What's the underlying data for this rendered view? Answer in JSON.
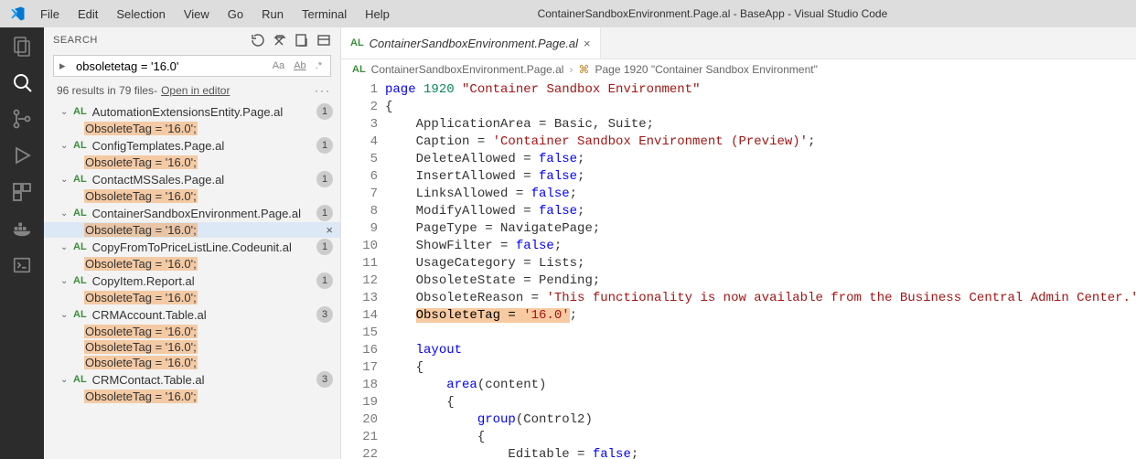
{
  "window_title": "ContainerSandboxEnvironment.Page.al - BaseApp - Visual Studio Code",
  "menubar": [
    "File",
    "Edit",
    "Selection",
    "View",
    "Go",
    "Run",
    "Terminal",
    "Help"
  ],
  "sidebar": {
    "heading": "SEARCH",
    "search_value": "obsoletetag = '16.0'",
    "results_count": "96 results in 79 files",
    "open_in_editor": "Open in editor",
    "match_text": "ObsoleteTag = '16.0';",
    "files": [
      {
        "name": "AutomationExtensionsEntity.Page.al",
        "badge": "1",
        "matches": 1
      },
      {
        "name": "ConfigTemplates.Page.al",
        "badge": "1",
        "matches": 1
      },
      {
        "name": "ContactMSSales.Page.al",
        "badge": "1",
        "matches": 1
      },
      {
        "name": "ContainerSandboxEnvironment.Page.al",
        "badge": "1",
        "matches": 1,
        "selected": true,
        "showClose": true
      },
      {
        "name": "CopyFromToPriceListLine.Codeunit.al",
        "badge": "1",
        "matches": 1
      },
      {
        "name": "CopyItem.Report.al",
        "badge": "1",
        "matches": 1
      },
      {
        "name": "CRMAccount.Table.al",
        "badge": "3",
        "matches": 3
      },
      {
        "name": "CRMContact.Table.al",
        "badge": "3",
        "matches": 1,
        "truncated": true
      }
    ]
  },
  "tabs": [
    {
      "type": "AL",
      "label": "ContainerSandboxEnvironment.Page.al",
      "italic": true
    }
  ],
  "breadcrumb": {
    "file": "ContainerSandboxEnvironment.Page.al",
    "symbol": "Page 1920 \"Container Sandbox Environment\""
  },
  "code": {
    "lines": [
      {
        "n": 1,
        "tokens": [
          [
            "kw",
            "page"
          ],
          [
            "sp",
            " "
          ],
          [
            "num",
            "1920"
          ],
          [
            "sp",
            " "
          ],
          [
            "str",
            "\"Container Sandbox Environment\""
          ]
        ]
      },
      {
        "n": 2,
        "tokens": [
          [
            "punc",
            "{"
          ]
        ]
      },
      {
        "n": 3,
        "tokens": [
          [
            "sp",
            "    "
          ],
          [
            "ident",
            "ApplicationArea = Basic, Suite;"
          ]
        ]
      },
      {
        "n": 4,
        "tokens": [
          [
            "sp",
            "    "
          ],
          [
            "ident",
            "Caption = "
          ],
          [
            "str",
            "'Container Sandbox Environment (Preview)'"
          ],
          [
            "ident",
            ";"
          ]
        ]
      },
      {
        "n": 5,
        "tokens": [
          [
            "sp",
            "    "
          ],
          [
            "ident",
            "DeleteAllowed = "
          ],
          [
            "kw",
            "false"
          ],
          [
            "ident",
            ";"
          ]
        ]
      },
      {
        "n": 6,
        "tokens": [
          [
            "sp",
            "    "
          ],
          [
            "ident",
            "InsertAllowed = "
          ],
          [
            "kw",
            "false"
          ],
          [
            "ident",
            ";"
          ]
        ]
      },
      {
        "n": 7,
        "tokens": [
          [
            "sp",
            "    "
          ],
          [
            "ident",
            "LinksAllowed = "
          ],
          [
            "kw",
            "false"
          ],
          [
            "ident",
            ";"
          ]
        ]
      },
      {
        "n": 8,
        "tokens": [
          [
            "sp",
            "    "
          ],
          [
            "ident",
            "ModifyAllowed = "
          ],
          [
            "kw",
            "false"
          ],
          [
            "ident",
            ";"
          ]
        ]
      },
      {
        "n": 9,
        "tokens": [
          [
            "sp",
            "    "
          ],
          [
            "ident",
            "PageType = NavigatePage;"
          ]
        ]
      },
      {
        "n": 10,
        "tokens": [
          [
            "sp",
            "    "
          ],
          [
            "ident",
            "ShowFilter = "
          ],
          [
            "kw",
            "false"
          ],
          [
            "ident",
            ";"
          ]
        ]
      },
      {
        "n": 11,
        "tokens": [
          [
            "sp",
            "    "
          ],
          [
            "ident",
            "UsageCategory = Lists;"
          ]
        ]
      },
      {
        "n": 12,
        "tokens": [
          [
            "sp",
            "    "
          ],
          [
            "ident",
            "ObsoleteState = Pending;"
          ]
        ]
      },
      {
        "n": 13,
        "tokens": [
          [
            "sp",
            "    "
          ],
          [
            "ident",
            "ObsoleteReason = "
          ],
          [
            "str",
            "'This functionality is now available from the Business Central Admin Center.'"
          ],
          [
            "ident",
            ";"
          ]
        ]
      },
      {
        "n": 14,
        "tokens": [
          [
            "sp",
            "    "
          ],
          [
            "hl",
            "ObsoleteTag = '16.0'"
          ],
          [
            "ident",
            ";"
          ]
        ]
      },
      {
        "n": 15,
        "tokens": [
          [
            "sp",
            ""
          ]
        ]
      },
      {
        "n": 16,
        "tokens": [
          [
            "sp",
            "    "
          ],
          [
            "kw",
            "layout"
          ]
        ]
      },
      {
        "n": 17,
        "tokens": [
          [
            "sp",
            "    "
          ],
          [
            "punc",
            "{"
          ]
        ]
      },
      {
        "n": 18,
        "tokens": [
          [
            "sp",
            "        "
          ],
          [
            "kw",
            "area"
          ],
          [
            "ident",
            "(content)"
          ]
        ]
      },
      {
        "n": 19,
        "tokens": [
          [
            "sp",
            "        "
          ],
          [
            "punc",
            "{"
          ]
        ]
      },
      {
        "n": 20,
        "tokens": [
          [
            "sp",
            "            "
          ],
          [
            "kw",
            "group"
          ],
          [
            "ident",
            "(Control2)"
          ]
        ]
      },
      {
        "n": 21,
        "tokens": [
          [
            "sp",
            "            "
          ],
          [
            "punc",
            "{"
          ]
        ]
      },
      {
        "n": 22,
        "tokens": [
          [
            "sp",
            "                "
          ],
          [
            "ident",
            "Editable = "
          ],
          [
            "kw",
            "false"
          ],
          [
            "ident",
            ";"
          ]
        ]
      }
    ]
  }
}
